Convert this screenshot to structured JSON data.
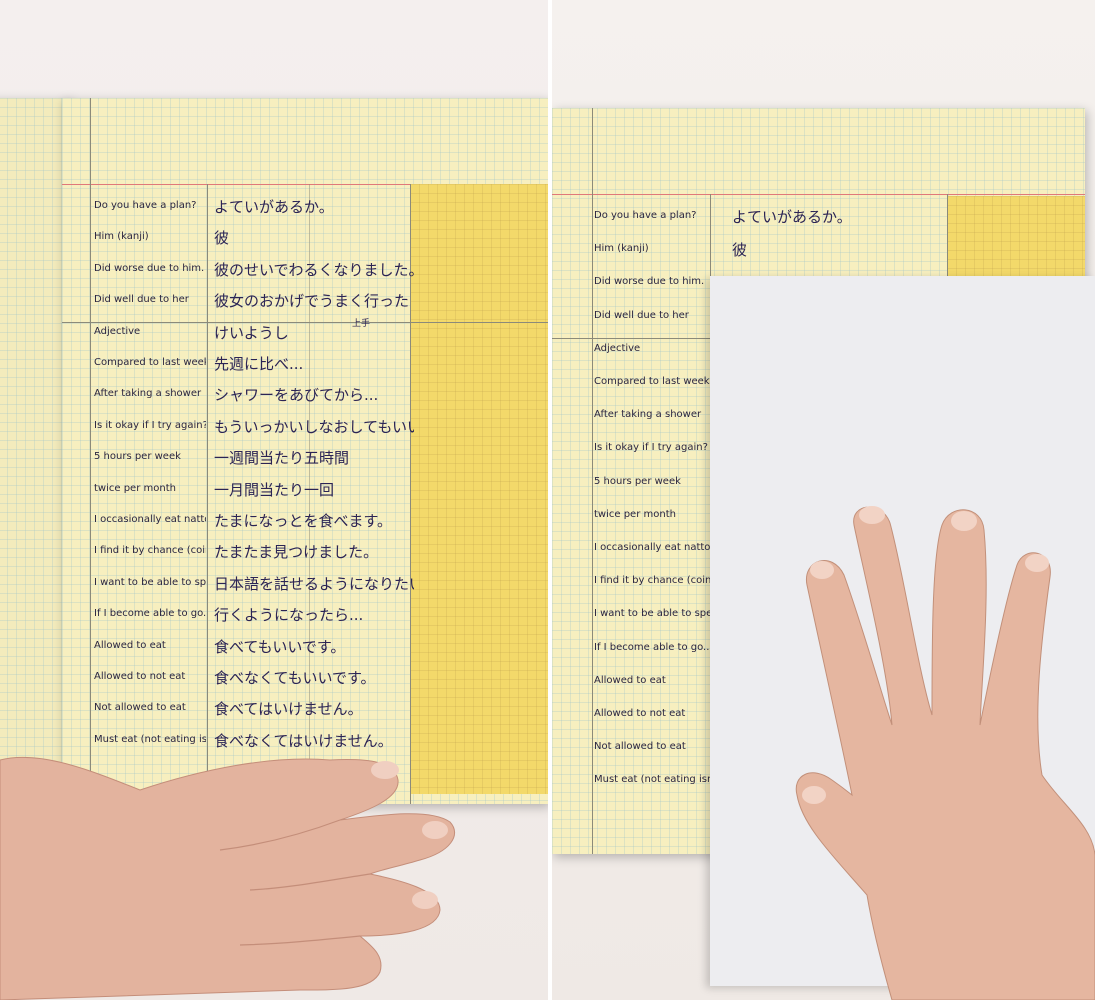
{
  "left_panel": {
    "rows": [
      {
        "en": "Do you have a plan?",
        "ja": "よていがあるか。"
      },
      {
        "en": "Him (kanji)",
        "ja": "彼"
      },
      {
        "en": "Did worse due to him.",
        "ja": "彼のせいでわるくなりました。"
      },
      {
        "en": "Did well due to her",
        "ja": "彼女のおかげでうまく行った"
      },
      {
        "en": "Adjective",
        "ja": "けいようし"
      },
      {
        "en": "Compared to last week..",
        "ja": "先週に比べ..."
      },
      {
        "en": "After taking a shower",
        "ja": "シャワーをあびてから..."
      },
      {
        "en": "Is it okay if I try again? (to do it)",
        "ja": "もういっかいしなおしてもいいですか。"
      },
      {
        "en": "5 hours per week",
        "ja": "一週間当たり五時間"
      },
      {
        "en": "twice per month",
        "ja": "一月間当たり一回"
      },
      {
        "en": "I occasionally eat natto",
        "ja": "たまになっとを食べます。"
      },
      {
        "en": "I find it by chance (coincidence)",
        "ja": "たまたま見つけました。"
      },
      {
        "en": "I want to be able to speak Japanese",
        "ja": "日本語を話せるようになりたい。"
      },
      {
        "en": "If I become able to go..",
        "ja": "行くようになったら..."
      },
      {
        "en": "Allowed to eat",
        "ja": "食べてもいいです。"
      },
      {
        "en": "Allowed to not eat",
        "ja": "食べなくてもいいです。"
      },
      {
        "en": "Not allowed to eat",
        "ja": "食べてはいけません。"
      },
      {
        "en": "Must eat (not eating isn't allowed)",
        "ja": "食べなくてはいけません。"
      }
    ],
    "annotation": "上手"
  },
  "right_panel": {
    "rows": [
      {
        "en": "Do you have a plan?",
        "ja": "よていがあるか。"
      },
      {
        "en": "Him (kanji)",
        "ja": "彼"
      },
      {
        "en": "Did worse due to him.",
        "ja": ""
      },
      {
        "en": "Did well due to her",
        "ja": ""
      },
      {
        "en": "Adjective",
        "ja": ""
      },
      {
        "en": "Compared to last week",
        "ja": ""
      },
      {
        "en": "After taking a shower",
        "ja": ""
      },
      {
        "en": "Is it okay if I try again? (to do it)",
        "ja": ""
      },
      {
        "en": "5 hours per week",
        "ja": ""
      },
      {
        "en": "twice per month",
        "ja": ""
      },
      {
        "en": "I occasionally eat natto",
        "ja": ""
      },
      {
        "en": "I find it by chance (coincidence)",
        "ja": ""
      },
      {
        "en": "I want to be able to speak Japanese",
        "ja": ""
      },
      {
        "en": "If I become able to go..",
        "ja": ""
      },
      {
        "en": "Allowed to eat",
        "ja": ""
      },
      {
        "en": "Allowed to not eat",
        "ja": ""
      },
      {
        "en": "Not allowed to eat",
        "ja": ""
      },
      {
        "en": "Must eat (not eating isn't allowed)",
        "ja": ""
      }
    ]
  },
  "colors": {
    "paper": "#f7efbf",
    "highlight": "#f3d96a",
    "ink": "#2b2455",
    "margin_line": "#e0787a"
  }
}
